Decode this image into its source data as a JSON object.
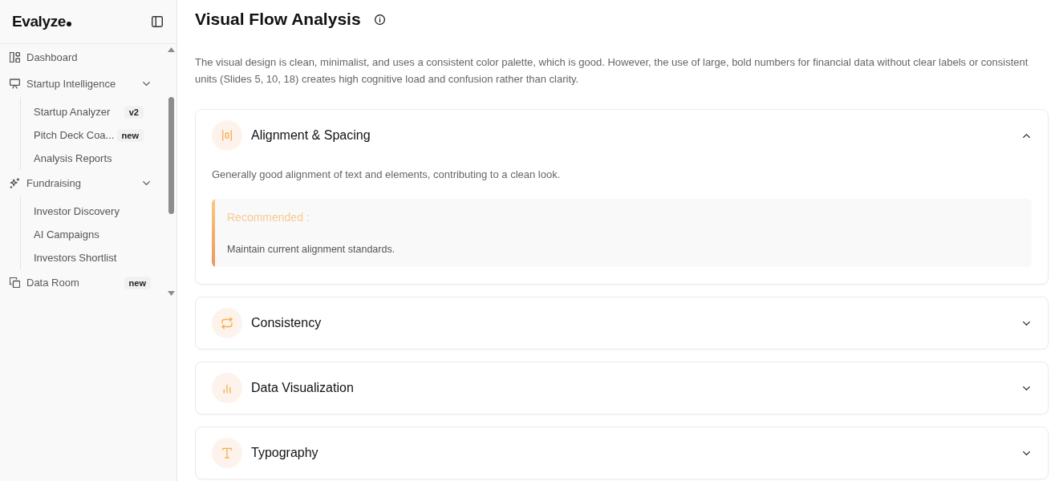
{
  "sidebar": {
    "logo": "Evalyze",
    "nav": [
      {
        "label": "Dashboard"
      },
      {
        "label": "Startup Intelligence",
        "expanded": true,
        "children": [
          {
            "label": "Startup Analyzer",
            "badge": "v2"
          },
          {
            "label": "Pitch Deck Coa...",
            "badge": "new"
          },
          {
            "label": "Analysis Reports"
          }
        ]
      },
      {
        "label": "Fundraising",
        "expanded": true,
        "children": [
          {
            "label": "Investor Discovery"
          },
          {
            "label": "AI Campaigns"
          },
          {
            "label": "Investors Shortlist"
          }
        ]
      },
      {
        "label": "Data Room",
        "badge": "new"
      }
    ]
  },
  "page": {
    "title": "Visual Flow Analysis",
    "summary": "The visual design is clean, minimalist, and uses a consistent color palette, which is good. However, the use of large, bold numbers for financial data without clear labels or consistent units (Slides 5, 10, 18) creates high cognitive load and confusion rather than clarity."
  },
  "sections": [
    {
      "title": "Alignment & Spacing",
      "expanded": true,
      "description": "Generally good alignment of text and elements, contributing to a clean look.",
      "recommendation": {
        "label": "Recommended :",
        "text": "Maintain current alignment standards."
      }
    },
    {
      "title": "Consistency",
      "expanded": false
    },
    {
      "title": "Data Visualization",
      "expanded": false
    },
    {
      "title": "Typography",
      "expanded": false
    }
  ]
}
